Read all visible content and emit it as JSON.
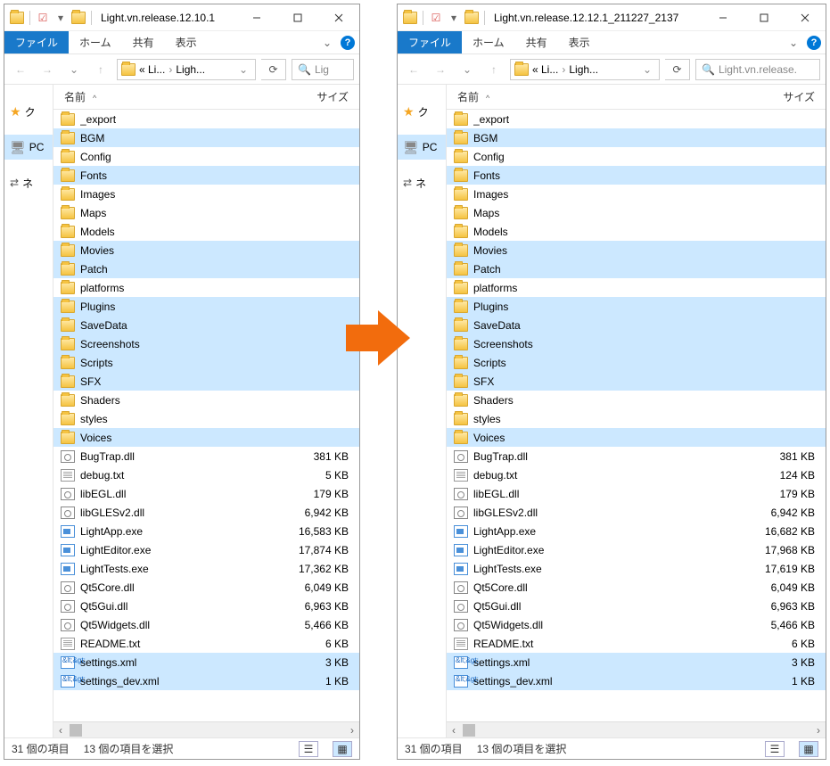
{
  "left": {
    "title": "Light.vn.release.12.10.1",
    "tabs": {
      "file": "ファイル",
      "home": "ホーム",
      "share": "共有",
      "view": "表示"
    },
    "breadcrumb": {
      "part1": "« Li...",
      "part2": "Ligh..."
    },
    "search_placeholder": "Lig",
    "columns": {
      "name": "名前",
      "size": "サイズ"
    },
    "sidebar": {
      "quick": "ク",
      "pc": "PC",
      "net": "ネ"
    },
    "items": [
      {
        "name": "_export",
        "type": "folder",
        "sel": false,
        "size": ""
      },
      {
        "name": "BGM",
        "type": "folder",
        "sel": true,
        "size": ""
      },
      {
        "name": "Config",
        "type": "folder",
        "sel": false,
        "size": ""
      },
      {
        "name": "Fonts",
        "type": "folder",
        "sel": true,
        "size": ""
      },
      {
        "name": "Images",
        "type": "folder",
        "sel": false,
        "size": ""
      },
      {
        "name": "Maps",
        "type": "folder",
        "sel": false,
        "size": ""
      },
      {
        "name": "Models",
        "type": "folder",
        "sel": false,
        "size": ""
      },
      {
        "name": "Movies",
        "type": "folder",
        "sel": true,
        "size": ""
      },
      {
        "name": "Patch",
        "type": "folder",
        "sel": true,
        "size": ""
      },
      {
        "name": "platforms",
        "type": "folder",
        "sel": false,
        "size": ""
      },
      {
        "name": "Plugins",
        "type": "folder",
        "sel": true,
        "size": ""
      },
      {
        "name": "SaveData",
        "type": "folder",
        "sel": true,
        "size": ""
      },
      {
        "name": "Screenshots",
        "type": "folder",
        "sel": true,
        "size": ""
      },
      {
        "name": "Scripts",
        "type": "folder",
        "sel": true,
        "size": ""
      },
      {
        "name": "SFX",
        "type": "folder",
        "sel": true,
        "size": ""
      },
      {
        "name": "Shaders",
        "type": "folder",
        "sel": false,
        "size": ""
      },
      {
        "name": "styles",
        "type": "folder",
        "sel": false,
        "size": ""
      },
      {
        "name": "Voices",
        "type": "folder",
        "sel": true,
        "size": ""
      },
      {
        "name": "BugTrap.dll",
        "type": "dll",
        "sel": false,
        "size": "381 KB"
      },
      {
        "name": "debug.txt",
        "type": "txt",
        "sel": false,
        "size": "5 KB"
      },
      {
        "name": "libEGL.dll",
        "type": "dll",
        "sel": false,
        "size": "179 KB"
      },
      {
        "name": "libGLESv2.dll",
        "type": "dll",
        "sel": false,
        "size": "6,942 KB"
      },
      {
        "name": "LightApp.exe",
        "type": "exe",
        "sel": false,
        "size": "16,583 KB"
      },
      {
        "name": "LightEditor.exe",
        "type": "exe",
        "sel": false,
        "size": "17,874 KB"
      },
      {
        "name": "LightTests.exe",
        "type": "exe",
        "sel": false,
        "size": "17,362 KB"
      },
      {
        "name": "Qt5Core.dll",
        "type": "dll",
        "sel": false,
        "size": "6,049 KB"
      },
      {
        "name": "Qt5Gui.dll",
        "type": "dll",
        "sel": false,
        "size": "6,963 KB"
      },
      {
        "name": "Qt5Widgets.dll",
        "type": "dll",
        "sel": false,
        "size": "5,466 KB"
      },
      {
        "name": "README.txt",
        "type": "txt",
        "sel": false,
        "size": "6 KB"
      },
      {
        "name": "settings.xml",
        "type": "xml",
        "sel": true,
        "size": "3 KB"
      },
      {
        "name": "settings_dev.xml",
        "type": "xml",
        "sel": true,
        "size": "1 KB"
      }
    ],
    "status": {
      "count": "31 個の項目",
      "sel": "13 個の項目を選択"
    }
  },
  "right": {
    "title": "Light.vn.release.12.12.1_211227_2137",
    "tabs": {
      "file": "ファイル",
      "home": "ホーム",
      "share": "共有",
      "view": "表示"
    },
    "breadcrumb": {
      "part1": "« Li...",
      "part2": "Ligh..."
    },
    "search_placeholder": "Light.vn.release.",
    "columns": {
      "name": "名前",
      "size": "サイズ"
    },
    "sidebar": {
      "quick": "ク",
      "pc": "PC",
      "net": "ネ"
    },
    "items": [
      {
        "name": "_export",
        "type": "folder",
        "sel": false,
        "size": ""
      },
      {
        "name": "BGM",
        "type": "folder",
        "sel": true,
        "size": ""
      },
      {
        "name": "Config",
        "type": "folder",
        "sel": false,
        "size": ""
      },
      {
        "name": "Fonts",
        "type": "folder",
        "sel": true,
        "size": ""
      },
      {
        "name": "Images",
        "type": "folder",
        "sel": false,
        "size": ""
      },
      {
        "name": "Maps",
        "type": "folder",
        "sel": false,
        "size": ""
      },
      {
        "name": "Models",
        "type": "folder",
        "sel": false,
        "size": ""
      },
      {
        "name": "Movies",
        "type": "folder",
        "sel": true,
        "size": ""
      },
      {
        "name": "Patch",
        "type": "folder",
        "sel": true,
        "size": ""
      },
      {
        "name": "platforms",
        "type": "folder",
        "sel": false,
        "size": ""
      },
      {
        "name": "Plugins",
        "type": "folder",
        "sel": true,
        "size": ""
      },
      {
        "name": "SaveData",
        "type": "folder",
        "sel": true,
        "size": ""
      },
      {
        "name": "Screenshots",
        "type": "folder",
        "sel": true,
        "size": ""
      },
      {
        "name": "Scripts",
        "type": "folder",
        "sel": true,
        "size": ""
      },
      {
        "name": "SFX",
        "type": "folder",
        "sel": true,
        "size": ""
      },
      {
        "name": "Shaders",
        "type": "folder",
        "sel": false,
        "size": ""
      },
      {
        "name": "styles",
        "type": "folder",
        "sel": false,
        "size": ""
      },
      {
        "name": "Voices",
        "type": "folder",
        "sel": true,
        "size": ""
      },
      {
        "name": "BugTrap.dll",
        "type": "dll",
        "sel": false,
        "size": "381 KB"
      },
      {
        "name": "debug.txt",
        "type": "txt",
        "sel": false,
        "size": "124 KB"
      },
      {
        "name": "libEGL.dll",
        "type": "dll",
        "sel": false,
        "size": "179 KB"
      },
      {
        "name": "libGLESv2.dll",
        "type": "dll",
        "sel": false,
        "size": "6,942 KB"
      },
      {
        "name": "LightApp.exe",
        "type": "exe",
        "sel": false,
        "size": "16,682 KB"
      },
      {
        "name": "LightEditor.exe",
        "type": "exe",
        "sel": false,
        "size": "17,968 KB"
      },
      {
        "name": "LightTests.exe",
        "type": "exe",
        "sel": false,
        "size": "17,619 KB"
      },
      {
        "name": "Qt5Core.dll",
        "type": "dll",
        "sel": false,
        "size": "6,049 KB"
      },
      {
        "name": "Qt5Gui.dll",
        "type": "dll",
        "sel": false,
        "size": "6,963 KB"
      },
      {
        "name": "Qt5Widgets.dll",
        "type": "dll",
        "sel": false,
        "size": "5,466 KB"
      },
      {
        "name": "README.txt",
        "type": "txt",
        "sel": false,
        "size": "6 KB"
      },
      {
        "name": "settings.xml",
        "type": "xml",
        "sel": true,
        "size": "3 KB"
      },
      {
        "name": "settings_dev.xml",
        "type": "xml",
        "sel": true,
        "size": "1 KB"
      }
    ],
    "status": {
      "count": "31 個の項目",
      "sel": "13 個の項目を選択"
    }
  }
}
